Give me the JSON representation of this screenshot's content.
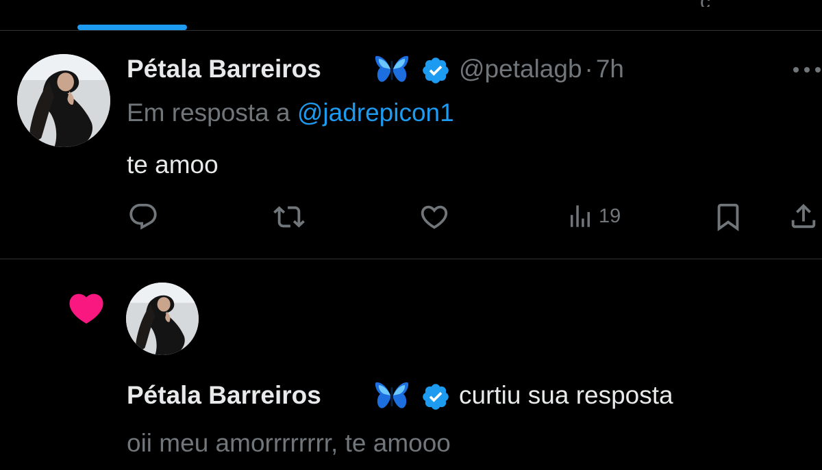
{
  "tabs": {
    "partial_label": "ç"
  },
  "tweet": {
    "author_name": "Pétala Barreiros",
    "handle": "@petalagb",
    "separator": "·",
    "time": "7h",
    "reply_prefix": "Em resposta a",
    "reply_to": "@jadrepicon1",
    "text": "te amoo",
    "views_count": "19"
  },
  "notification": {
    "author_name": "Pétala Barreiros",
    "action_text": "curtiu sua resposta",
    "preview_text": "oii meu amorrrrrrrr, te amooo"
  },
  "colors": {
    "background": "#000000",
    "accent": "#1d9bf0",
    "text": "#e7e9ea",
    "muted": "#71767b",
    "like_pink": "#f91880",
    "divider": "#2f3336"
  },
  "icons": {
    "author_badge_emoji": "butterfly-icon",
    "verified": "verified-badge-icon",
    "actions": [
      "reply-icon",
      "retweet-icon",
      "like-icon",
      "views-icon",
      "bookmark-icon",
      "share-icon"
    ],
    "notification": "heart-filled-icon"
  }
}
